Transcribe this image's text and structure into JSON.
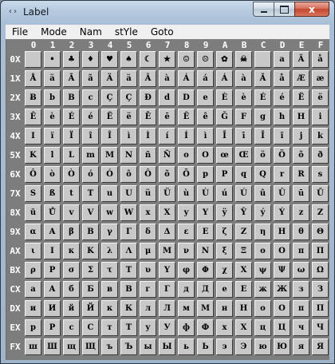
{
  "window": {
    "title": "Label",
    "app_icon": "code-brackets-icon",
    "controls": {
      "minimize": "minimize-icon",
      "maximize": "maximize-icon",
      "close_glyph": "x"
    }
  },
  "menu": [
    "File",
    "Mode",
    "Nam",
    "stYle",
    "Goto"
  ],
  "column_headers": [
    "0",
    "1",
    "2",
    "3",
    "4",
    "5",
    "6",
    "7",
    "8",
    "9",
    "A",
    "B",
    "C",
    "D",
    "E",
    "F"
  ],
  "rows": [
    {
      "label": "0X",
      "cells": [
        " ",
        "•",
        "♣",
        "♦",
        "♥",
        "♠",
        "☾",
        "★",
        "☺",
        "☹",
        "✿",
        "☠",
        " ",
        "a",
        "Ä",
        "å"
      ]
    },
    {
      "label": "1X",
      "cells": [
        "Å",
        "ä",
        "Ã",
        "ã",
        "Ä",
        "ä",
        "Â",
        "à",
        "Á",
        "á",
        "Á",
        "à",
        "Ă",
        "å",
        "Æ",
        "æ"
      ]
    },
    {
      "label": "2X",
      "cells": [
        "Ƀ",
        "b",
        "B",
        "c",
        "Ç",
        "Ç",
        "Đ",
        "d",
        "D",
        "e",
        "È",
        "è",
        "É",
        "é",
        "Ë",
        "ë"
      ]
    },
    {
      "label": "3X",
      "cells": [
        "Ê",
        "è",
        "É",
        "é",
        "Ë",
        "ë",
        "Ē",
        "ē",
        "Ê",
        "ê",
        "Ğ",
        "F",
        "g",
        "h",
        "H",
        "i"
      ]
    },
    {
      "label": "4X",
      "cells": [
        "I",
        "ï",
        "Ï",
        "î",
        "Î",
        "ì",
        "Ì",
        "í",
        "Í",
        "ì",
        "Ī",
        "ī",
        "Ī",
        "ĩ",
        "j",
        "k"
      ]
    },
    {
      "label": "5X",
      "cells": [
        "K",
        "l",
        "L",
        "m",
        "M",
        "N",
        "ñ",
        "Ñ",
        "o",
        "O",
        "œ",
        "Œ",
        "ö",
        "Ö",
        "õ",
        "ð"
      ]
    },
    {
      "label": "6X",
      "cells": [
        "Ô",
        "ò",
        "Ò",
        "ó",
        "Ó",
        "ô",
        "Ô",
        "õ",
        "Õ",
        "p",
        "P",
        "q",
        "Q",
        "r",
        "R",
        "s"
      ]
    },
    {
      "label": "7X",
      "cells": [
        "S",
        "ß",
        "t",
        "T",
        "u",
        "U",
        "ü",
        "Ü",
        "ù",
        "Ù",
        "ú",
        "Ú",
        "û",
        "Û",
        "ū",
        "Ū"
      ]
    },
    {
      "label": "8X",
      "cells": [
        "ŭ",
        "Ů",
        "v",
        "V",
        "w",
        "W",
        "x",
        "X",
        "y",
        "Y",
        "ÿ",
        "Ŷ",
        "ý",
        "Ý",
        "z",
        "Z"
      ]
    },
    {
      "label": "9X",
      "cells": [
        "α",
        "A",
        "β",
        "B",
        "γ",
        "Γ",
        "δ",
        "Δ",
        "ε",
        "E",
        "ζ",
        "Z",
        "η",
        "H",
        "θ",
        "Θ"
      ]
    },
    {
      "label": "AX",
      "cells": [
        "ι",
        "I",
        "κ",
        "K",
        "λ",
        "Λ",
        "μ",
        "M",
        "ν",
        "N",
        "ξ",
        "Ξ",
        "ο",
        "O",
        "π",
        "Π"
      ]
    },
    {
      "label": "BX",
      "cells": [
        "ρ",
        "P",
        "σ",
        "Σ",
        "τ",
        "T",
        "υ",
        "Υ",
        "φ",
        "Φ",
        "χ",
        "X",
        "ψ",
        "Ψ",
        "ω",
        "Ω"
      ]
    },
    {
      "label": "CX",
      "cells": [
        "а",
        "А",
        "б",
        "Б",
        "в",
        "В",
        "г",
        "Г",
        "д",
        "Д",
        "е",
        "Е",
        "ж",
        "Ж",
        "з",
        "З"
      ]
    },
    {
      "label": "DX",
      "cells": [
        "и",
        "И",
        "й",
        "Й",
        "к",
        "К",
        "л",
        "Л",
        "м",
        "М",
        "н",
        "Н",
        "о",
        "О",
        "п",
        "П"
      ]
    },
    {
      "label": "EX",
      "cells": [
        "р",
        "Р",
        "с",
        "С",
        "т",
        "Т",
        "у",
        "У",
        "ф",
        "Ф",
        "х",
        "Х",
        "ц",
        "Ц",
        "ч",
        "Ч"
      ]
    },
    {
      "label": "FX",
      "cells": [
        "ш",
        "Ш",
        "щ",
        "Щ",
        "ъ",
        "Ъ",
        "ы",
        "Ы",
        "ь",
        "Ь",
        "э",
        "Э",
        "ю",
        "Ю",
        "я",
        "Я"
      ]
    }
  ]
}
